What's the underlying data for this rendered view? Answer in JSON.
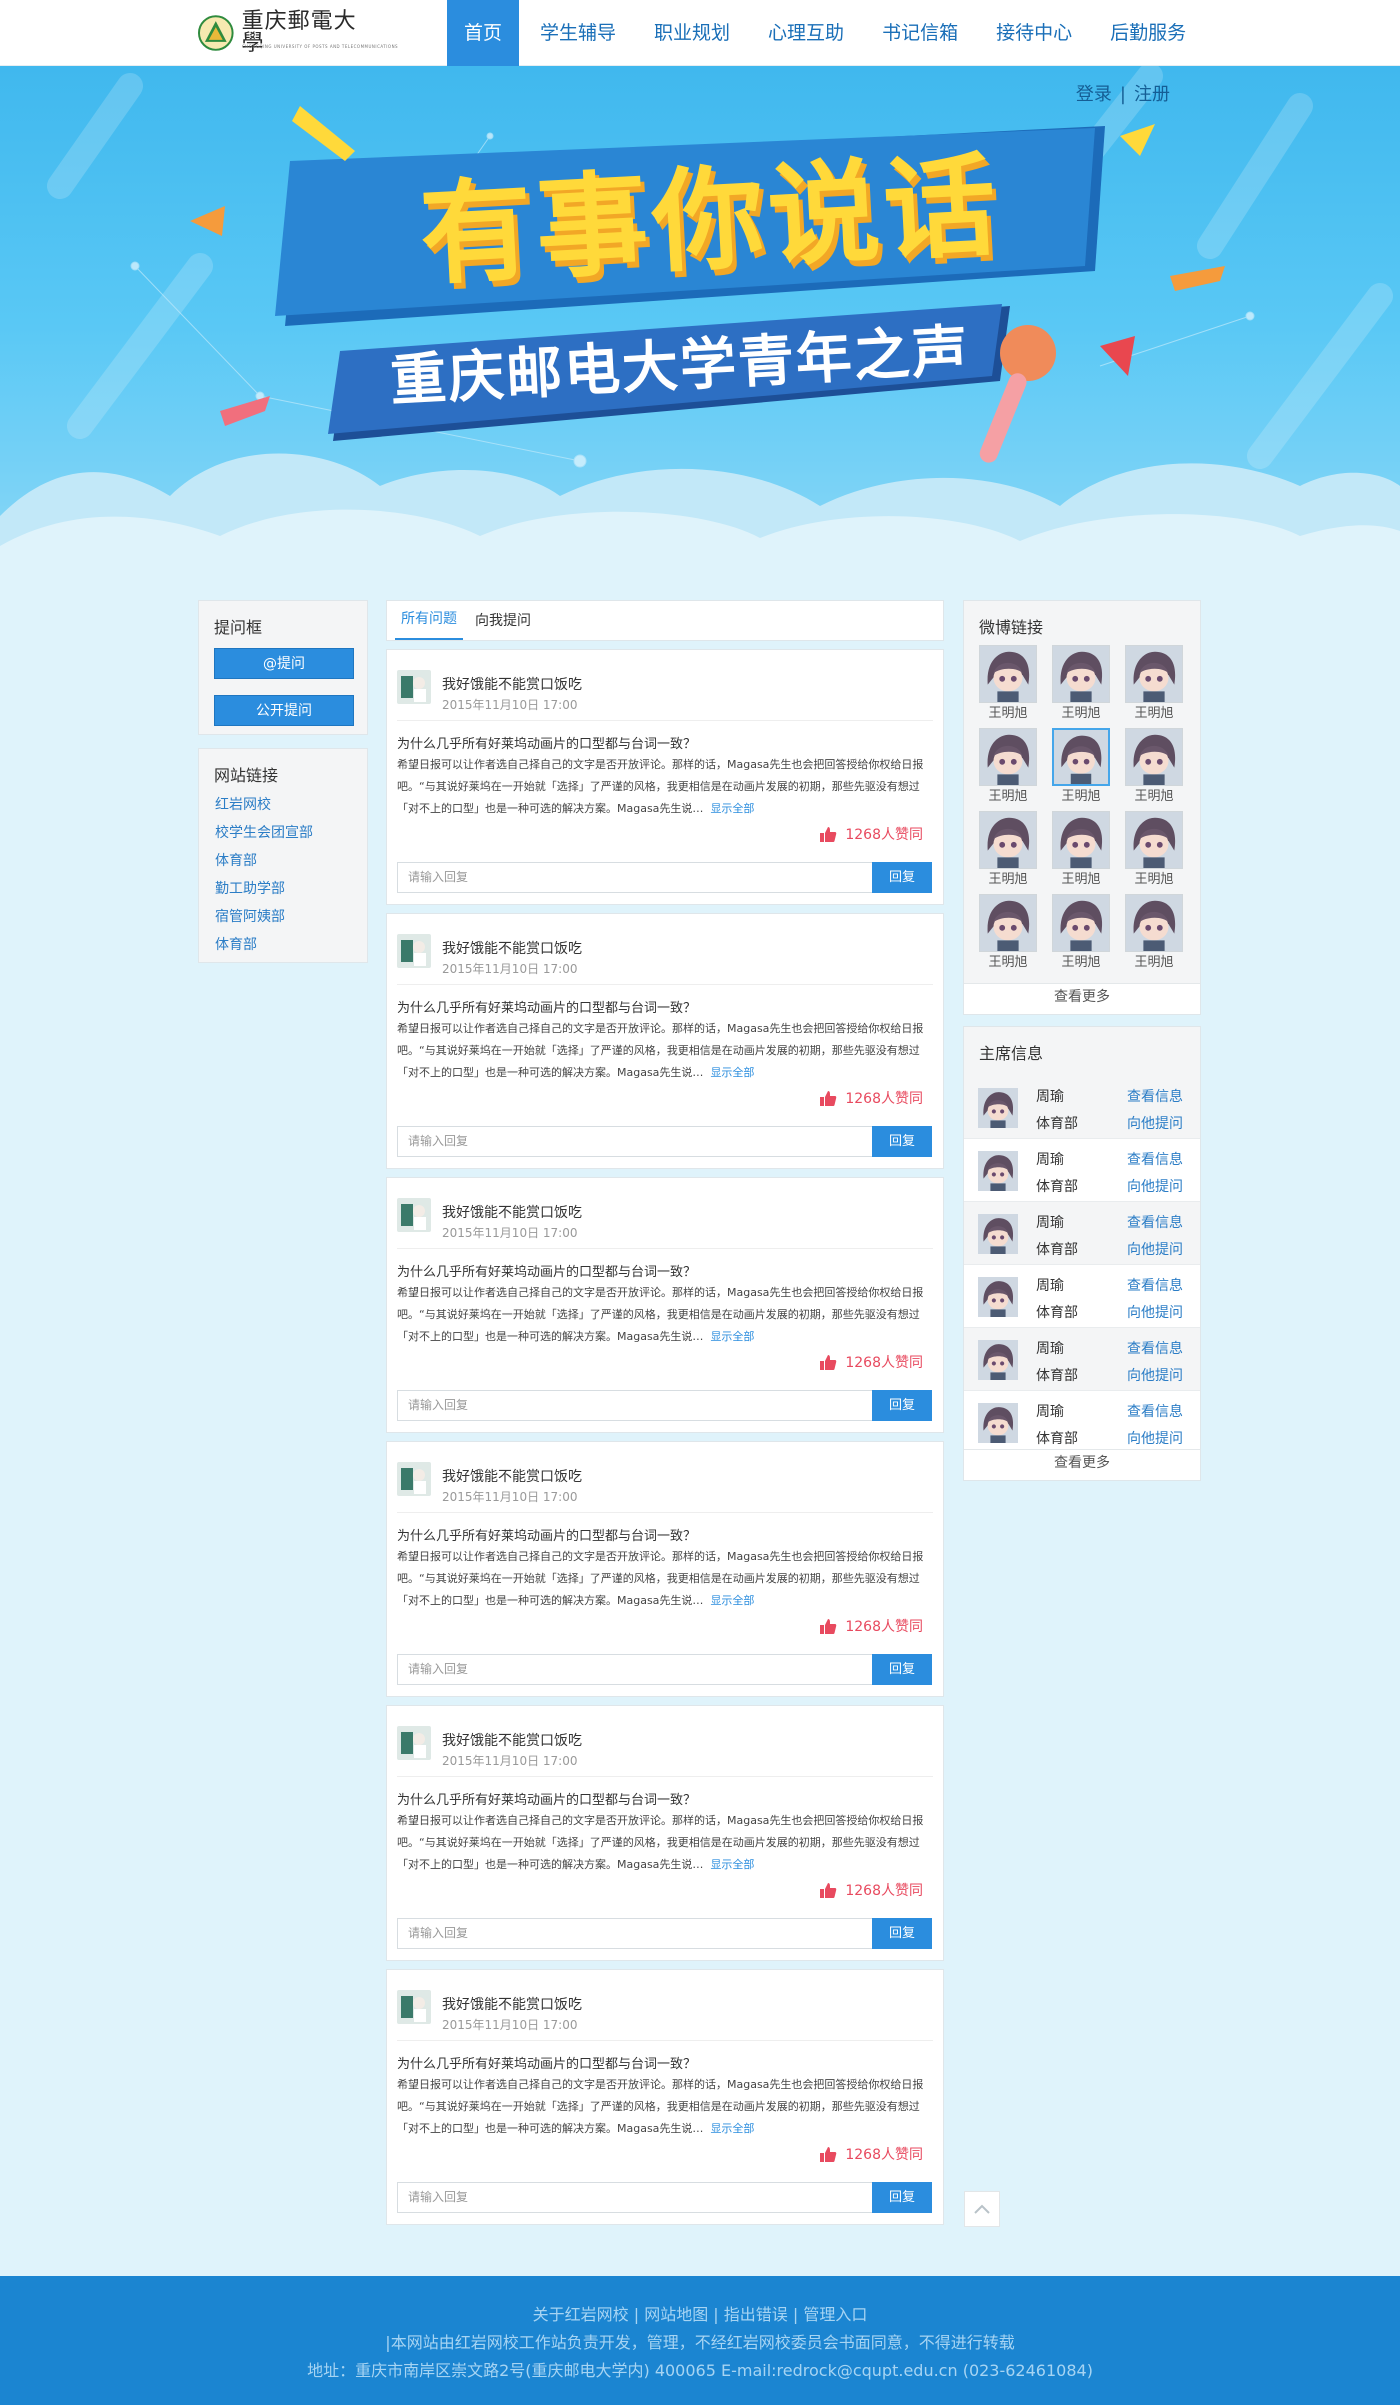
{
  "logo": {
    "school": "重庆郵電大學",
    "sub": "CHONGQING UNIVERSITY OF POSTS AND TELECOMMUNICATIONS"
  },
  "nav": [
    "首页",
    "学生辅导",
    "职业规划",
    "心理互助",
    "书记信箱",
    "接待中心",
    "后勤服务"
  ],
  "auth": {
    "login": "登录",
    "sep": "|",
    "register": "注册"
  },
  "banner": {
    "headline": "有事你说话",
    "subline": "重庆邮电大学青年之声"
  },
  "ask_box": {
    "title": "提问框",
    "at_btn": "@提问",
    "public_btn": "公开提问"
  },
  "site_links": {
    "title": "网站链接",
    "items": [
      "红岩网校",
      "校学生会团宣部",
      "体育部",
      "勤工助学部",
      "宿管阿姨部",
      "体育部"
    ]
  },
  "tabs": [
    "所有问题",
    "向我提问"
  ],
  "post": {
    "title": "我好饿能不能赏口饭吃",
    "date": "2015年11月10日   17:00",
    "question": "为什么几乎所有好莱坞动画片的口型都与台词一致？",
    "body": "希望日报可以让作者选自己择自己的文字是否开放评论。那样的话，Magasa先生也会把回答授给你权给日报吧。“与其说好莱坞在一开始就「选择」了严谨的风格，我更相信是在动画片发展的初期，那些先驱没有想过「对不上的口型」也是一种可选的解决方案。Magasa先生说…",
    "more": "显示全部",
    "likes": "1268人赞同",
    "reply_placeholder": "请输入回复",
    "reply_btn": "回复"
  },
  "weibo": {
    "title": "微博链接",
    "name": "王明旭",
    "more": "查看更多"
  },
  "chairs": {
    "title": "主席信息",
    "name": "周瑜",
    "dept": "体育部",
    "info": "查看信息",
    "ask": "向他提问",
    "more": "查看更多"
  },
  "footer": {
    "links": "关于红岩网校 | 网站地图 | 指出错误 | 管理入口",
    "notice": "|本网站由红岩网校工作站负责开发，管理，不经红岩网校委员会书面同意，不得进行转载",
    "address": "地址：重庆市南岸区崇文路2号(重庆邮电大学内) 400065 E-mail:redrock@cqupt.edu.cn (023-62461084)"
  },
  "colors": {
    "accent": "#2b8dde",
    "like": "#e84a5f",
    "footer": "#1b85d1",
    "banner_yellow": "#ffd93a"
  }
}
